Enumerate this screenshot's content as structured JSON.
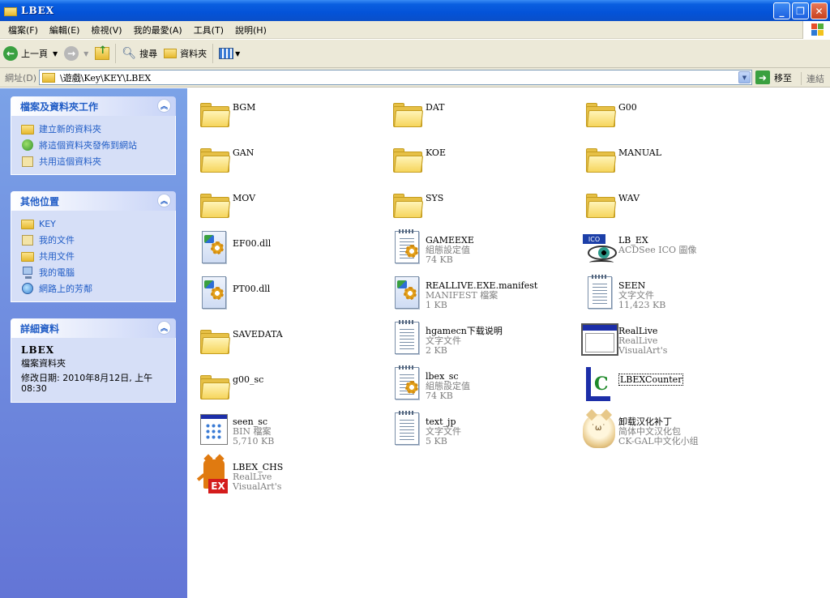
{
  "window": {
    "title": "LBEX"
  },
  "menu": [
    "檔案(F)",
    "編輯(E)",
    "檢視(V)",
    "我的最愛(A)",
    "工具(T)",
    "說明(H)"
  ],
  "toolbar": {
    "back": "上一頁",
    "search": "搜尋",
    "folders": "資料夾"
  },
  "address": {
    "label": "網址(D)",
    "path": "\\遊戲\\Key\\KEY\\LBEX",
    "go": "移至",
    "links": "連結"
  },
  "tasks": {
    "title": "檔案及資料夾工作",
    "items": [
      "建立新的資料夾",
      "將這個資料夾發佈到網站",
      "共用這個資料夾"
    ]
  },
  "places": {
    "title": "其他位置",
    "items": [
      "KEY",
      "我的文件",
      "共用文件",
      "我的電腦",
      "網路上的芳鄰"
    ]
  },
  "details": {
    "title": "詳細資料",
    "name": "LBEX",
    "type": "檔案資料夾",
    "date": "修改日期: 2010年8月12日, 上午 08:30"
  },
  "files": [
    {
      "name": "BGM",
      "l2": "",
      "l3": "",
      "icon": "folder-icon"
    },
    {
      "name": "DAT",
      "l2": "",
      "l3": "",
      "icon": "folder-icon"
    },
    {
      "name": "G00",
      "l2": "",
      "l3": "",
      "icon": "folder-icon"
    },
    {
      "name": "GAN",
      "l2": "",
      "l3": "",
      "icon": "folder-icon"
    },
    {
      "name": "KOE",
      "l2": "",
      "l3": "",
      "icon": "folder-icon"
    },
    {
      "name": "MANUAL",
      "l2": "",
      "l3": "",
      "icon": "folder-icon"
    },
    {
      "name": "MOV",
      "l2": "",
      "l3": "",
      "icon": "folder-icon"
    },
    {
      "name": "SYS",
      "l2": "",
      "l3": "",
      "icon": "folder-icon"
    },
    {
      "name": "WAV",
      "l2": "",
      "l3": "",
      "icon": "folder-icon"
    },
    {
      "name": "EF00.dll",
      "l2": "",
      "l3": "",
      "icon": "dll-icon"
    },
    {
      "name": "GAMEEXE",
      "l2": "組態設定值",
      "l3": "74 KB",
      "icon": "config-icon"
    },
    {
      "name": "LB_EX",
      "l2": "ACDSee ICO 圖像",
      "l3": "",
      "icon": "ico-icon"
    },
    {
      "name": "PT00.dll",
      "l2": "",
      "l3": "",
      "icon": "dll-icon"
    },
    {
      "name": "REALLIVE.EXE.manifest",
      "l2": "MANIFEST 檔案",
      "l3": "1 KB",
      "icon": "manifest-icon"
    },
    {
      "name": "SEEN",
      "l2": "文字文件",
      "l3": "11,423 KB",
      "icon": "text-icon"
    },
    {
      "name": "SAVEDATA",
      "l2": "",
      "l3": "",
      "icon": "folder-icon"
    },
    {
      "name": "hgamecn下载说明",
      "l2": "文字文件",
      "l3": "2 KB",
      "icon": "text-icon"
    },
    {
      "name": "RealLive",
      "l2": "RealLive",
      "l3": "VisualArt's",
      "icon": "app-window-icon"
    },
    {
      "name": "g00_sc",
      "l2": "",
      "l3": "",
      "icon": "folder-icon"
    },
    {
      "name": "lbex_sc",
      "l2": "組態設定值",
      "l3": "74 KB",
      "icon": "config-icon"
    },
    {
      "name": "LBEXCounter",
      "l2": "",
      "l3": "",
      "icon": "counter-icon"
    },
    {
      "name": "seen_sc",
      "l2": "BIN 檔案",
      "l3": "5,710 KB",
      "icon": "bin-icon"
    },
    {
      "name": "text_jp",
      "l2": "文字文件",
      "l3": "5 KB",
      "icon": "text-icon"
    },
    {
      "name": "卸载汉化补丁",
      "l2": "简体中文汉化包",
      "l3": "CK-GAL中文化小组",
      "icon": "cat-icon"
    },
    {
      "name": "LBEX_CHS",
      "l2": "RealLive",
      "l3": "VisualArt's",
      "icon": "lbex-cat-icon"
    }
  ]
}
